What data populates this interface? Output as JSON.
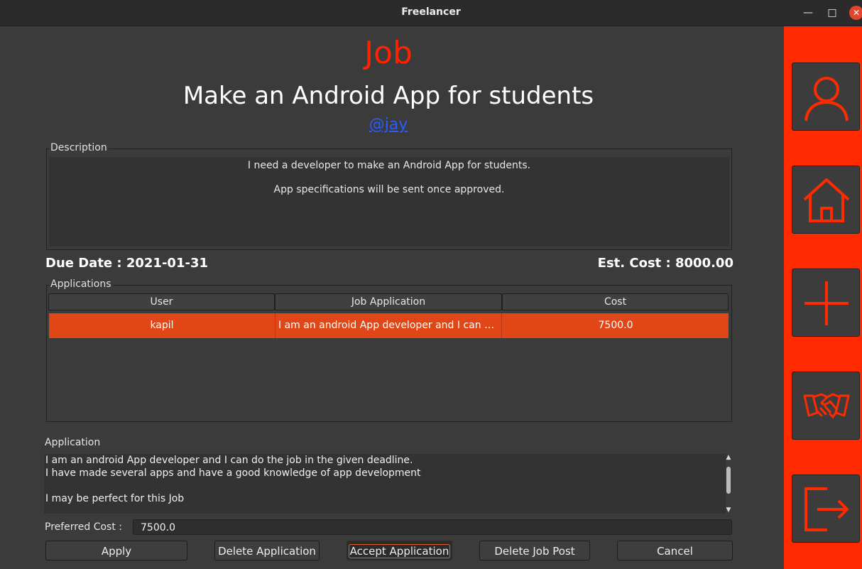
{
  "window": {
    "title": "Freelancer",
    "minimize": "—",
    "maximize": "□",
    "close": "✕"
  },
  "header": {
    "section": "Job",
    "job_title": "Make an Android App for students",
    "poster": "@jay"
  },
  "description": {
    "label": "Description",
    "lines": [
      "I need a developer to make an Android App for students.",
      "App specifications will be sent once approved."
    ]
  },
  "info": {
    "due_date": "Due Date : 2021-01-31",
    "est_cost": "Est. Cost : 8000.00"
  },
  "applications": {
    "label": "Applications",
    "columns": [
      "User",
      "Job Application",
      "Cost"
    ],
    "rows": [
      {
        "user": "kapil",
        "application": "I am an android App developer and I can do t...",
        "cost": "7500.0"
      }
    ]
  },
  "application_detail": {
    "label": "Application",
    "text": "I am an android App developer and I can do the job in the given deadline.\nI have made several apps and have a good knowledge of app development\n\nI may be perfect for this Job"
  },
  "preferred_cost": {
    "label": "Preferred Cost :",
    "value": "7500.0"
  },
  "buttons": {
    "apply": "Apply",
    "delete_application": "Delete Application",
    "accept_application": "Accept Application",
    "delete_job_post": "Delete Job Post",
    "cancel": "Cancel"
  },
  "sidebar": {
    "icons": [
      "user-icon",
      "home-icon",
      "plus-icon",
      "handshake-icon",
      "logout-icon"
    ]
  },
  "colors": {
    "accent": "#ff2a00",
    "selection": "#e04616",
    "link": "#2b5cff"
  }
}
